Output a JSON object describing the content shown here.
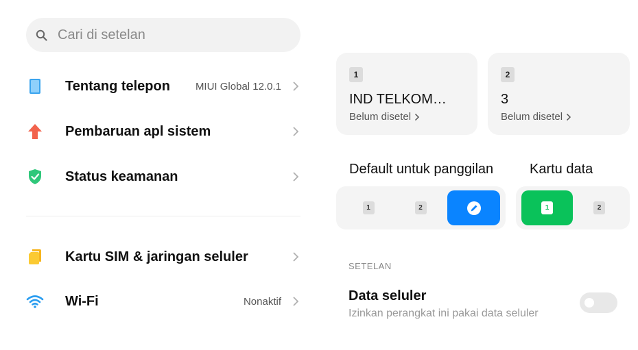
{
  "search": {
    "placeholder": "Cari di setelan"
  },
  "menu": {
    "tentang": {
      "label": "Tentang telepon",
      "value": "MIUI Global 12.0.1"
    },
    "pembaruan": {
      "label": "Pembaruan apl sistem"
    },
    "keamanan": {
      "label": "Status keamanan"
    },
    "sim": {
      "label": "Kartu SIM & jaringan seluler"
    },
    "wifi": {
      "label": "Wi-Fi",
      "value": "Nonaktif"
    }
  },
  "sim_cards": [
    {
      "slot": "1",
      "name": "IND TELKOM…",
      "status": "Belum disetel"
    },
    {
      "slot": "2",
      "name": "3",
      "status": "Belum disetel"
    }
  ],
  "call_default": {
    "title": "Default untuk panggilan",
    "options": [
      "1",
      "2"
    ],
    "selected": "ask"
  },
  "data_card": {
    "title": "Kartu data",
    "options": [
      "1",
      "2"
    ],
    "selected": "1"
  },
  "setelan": {
    "label": "SETELAN"
  },
  "mobile_data": {
    "title": "Data seluler",
    "subtitle": "Izinkan perangkat ini pakai data seluler",
    "enabled": false
  },
  "colors": {
    "accent_blue": "#0a84ff",
    "accent_green": "#0ac25a",
    "bg_card": "#f4f4f4"
  },
  "icons": {
    "tentang": "phone-icon",
    "pembaruan": "update-arrow-icon",
    "keamanan": "shield-check-icon",
    "sim": "sim-card-icon",
    "wifi": "wifi-icon"
  }
}
